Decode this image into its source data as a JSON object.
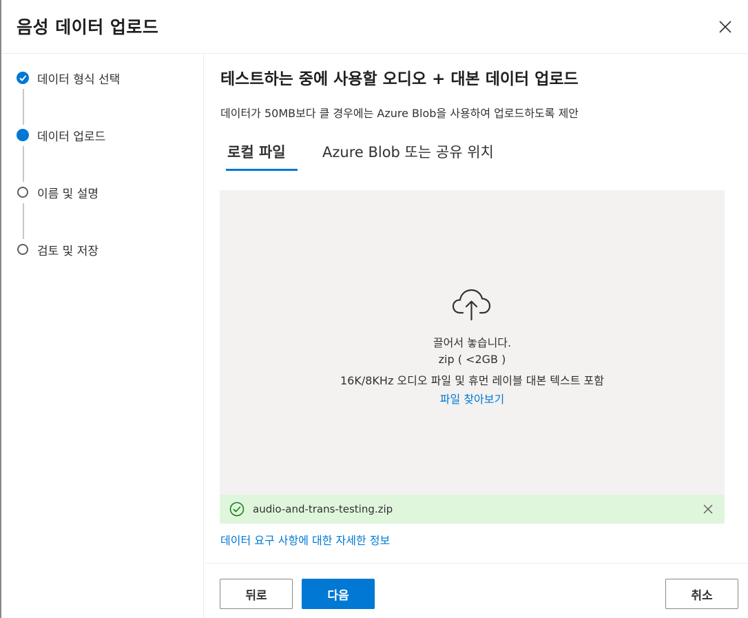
{
  "dialog": {
    "title": "음성 데이터 업로드",
    "close_icon": "close-icon"
  },
  "steps": [
    {
      "label": "데이터 형식 선택",
      "status": "done"
    },
    {
      "label": "데이터 업로드",
      "status": "current"
    },
    {
      "label": "이름 및 설명",
      "status": "todo"
    },
    {
      "label": "검토 및 저장",
      "status": "todo"
    }
  ],
  "main": {
    "title": "테스트하는 중에 사용할 오디오 + 대본 데이터 업로드",
    "subtitle": "데이터가 50MB보다 클 경우에는 Azure Blob을 사용하여 업로드하도록 제안",
    "tabs": [
      {
        "label": "로컬 파일",
        "active": true
      },
      {
        "label": "Azure Blob 또는 공유 위치",
        "active": false
      }
    ]
  },
  "dropzone": {
    "icon": "cloud-upload-icon",
    "drop_text": "끌어서 놓습니다.",
    "format_text": "zip ( <2GB )",
    "content_text": "16K/8KHz 오디오 파일 및 휴먼 레이블 대본 텍스트 포함",
    "browse_label": "파일 찾아보기"
  },
  "uploaded_file": {
    "name": "audio-and-trans-testing.zip",
    "status_icon": "check-circle-icon"
  },
  "info_link": "데이터 요구 사항에 대한 자세한 정보",
  "footer": {
    "back_label": "뒤로",
    "next_label": "다음",
    "cancel_label": "취소"
  },
  "colors": {
    "accent": "#0078d4",
    "success_bg": "#dff6dd",
    "success_icon": "#107c10",
    "dropzone_bg": "#f3f2f1"
  }
}
